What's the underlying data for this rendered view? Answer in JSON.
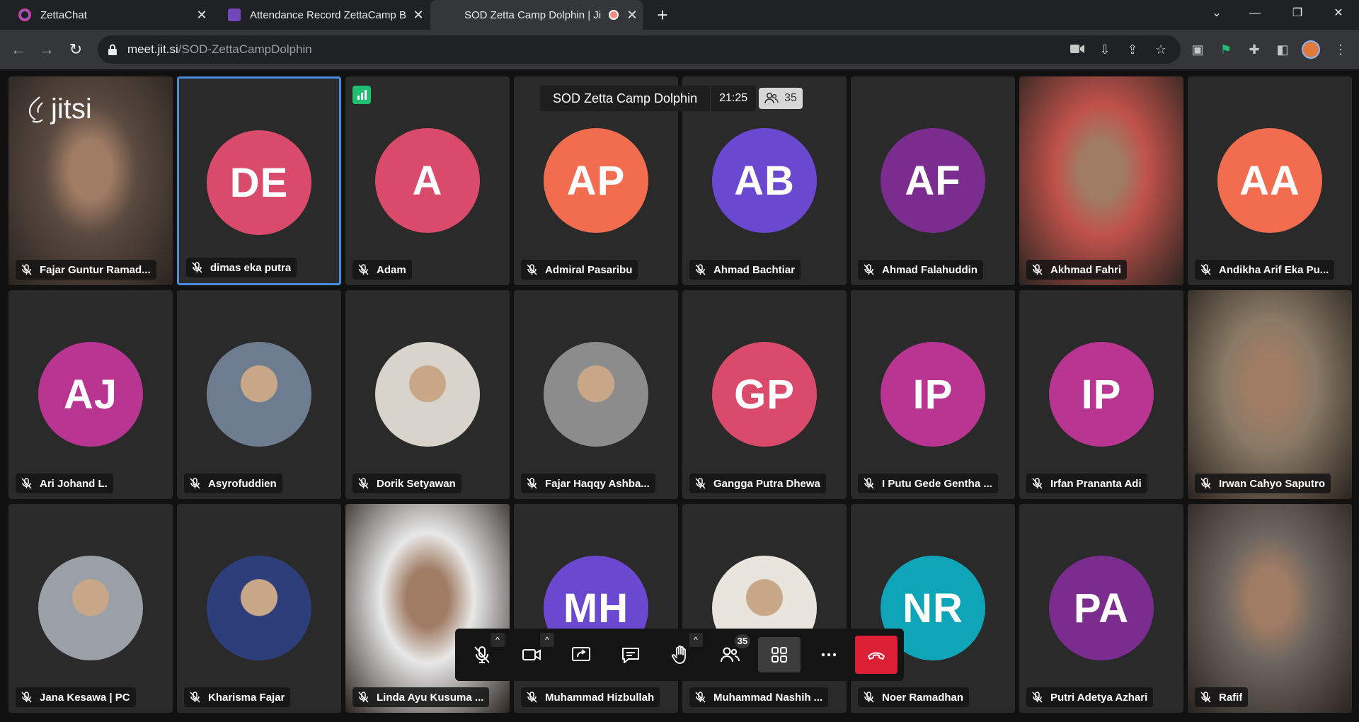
{
  "browser": {
    "tabs": [
      {
        "title": "ZettaChat",
        "icon": "zettachat-icon",
        "active": false
      },
      {
        "title": "Attendance Record ZettaCamp B",
        "icon": "list-icon",
        "active": false
      },
      {
        "title": "SOD Zetta Camp Dolphin | Ji",
        "icon": "jitsi-icon",
        "active": true
      }
    ],
    "url_host": "meet.jit.si",
    "url_path": "/SOD-ZettaCampDolphin"
  },
  "meeting": {
    "watermark": "jitsi",
    "subject": "SOD Zetta Camp Dolphin",
    "timer": "21:25",
    "participant_count": "35",
    "participants_badge": "35",
    "tiles": [
      {
        "name": "Fajar Guntur Ramad...",
        "type": "video",
        "bg": "#5a4a40"
      },
      {
        "name": "dimas eka putra",
        "type": "avatar",
        "initials": "DE",
        "color": "#d94a6b",
        "speaker": true
      },
      {
        "name": "Adam",
        "type": "avatar",
        "initials": "A",
        "color": "#d94a6b"
      },
      {
        "name": "Admiral Pasaribu",
        "type": "avatar",
        "initials": "AP",
        "color": "#f26d4f"
      },
      {
        "name": "Ahmad Bachtiar",
        "type": "avatar",
        "initials": "AB",
        "color": "#6b48d0"
      },
      {
        "name": "Ahmad Falahuddin",
        "type": "avatar",
        "initials": "AF",
        "color": "#7b2d8f"
      },
      {
        "name": "Akhmad Fahri",
        "type": "video",
        "bg": "#c0524a"
      },
      {
        "name": "Andikha Arif Eka Pu...",
        "type": "avatar",
        "initials": "AA",
        "color": "#f26d4f"
      },
      {
        "name": "Ari Johand L.",
        "type": "avatar",
        "initials": "AJ",
        "color": "#b83592"
      },
      {
        "name": "Asyrofuddien",
        "type": "photo",
        "bg": "#6e7c8f"
      },
      {
        "name": "Dorik Setyawan",
        "type": "photo",
        "bg": "#d8d4cc"
      },
      {
        "name": "Fajar Haqqy Ashba...",
        "type": "photo",
        "bg": "#8c8c8c"
      },
      {
        "name": "Gangga Putra Dhewa",
        "type": "avatar",
        "initials": "GP",
        "color": "#d94a6b"
      },
      {
        "name": "I Putu Gede Gentha ...",
        "type": "avatar",
        "initials": "IP",
        "color": "#b83592"
      },
      {
        "name": "Irfan Prananta Adi",
        "type": "avatar",
        "initials": "IP",
        "color": "#b83592"
      },
      {
        "name": "Irwan Cahyo Saputro",
        "type": "video",
        "bg": "#8a7a66"
      },
      {
        "name": "Jana Kesawa | PC",
        "type": "photo",
        "bg": "#9aa0a6"
      },
      {
        "name": "Kharisma Fajar",
        "type": "photo",
        "bg": "#2d3f7a"
      },
      {
        "name": "Linda Ayu Kusuma ...",
        "type": "video",
        "bg": "#e8e8e8"
      },
      {
        "name": "Muhammad Hizbullah",
        "type": "avatar",
        "initials": "MH",
        "color": "#6b48d0"
      },
      {
        "name": "Muhammad Nashih ...",
        "type": "photo",
        "bg": "#e9e4dc"
      },
      {
        "name": "Noer Ramadhan",
        "type": "avatar",
        "initials": "NR",
        "color": "#0fa5b8"
      },
      {
        "name": "Putri Adetya Azhari",
        "type": "avatar",
        "initials": "PA",
        "color": "#7b2d8f"
      },
      {
        "name": "Rafif",
        "type": "video",
        "bg": "#6d6660"
      }
    ]
  },
  "toolbox": {
    "buttons": [
      "microphone-button",
      "camera-button",
      "screenshare-button",
      "chat-button",
      "raise-hand-button",
      "participants-button",
      "tile-view-button",
      "more-button",
      "hangup-button"
    ]
  }
}
